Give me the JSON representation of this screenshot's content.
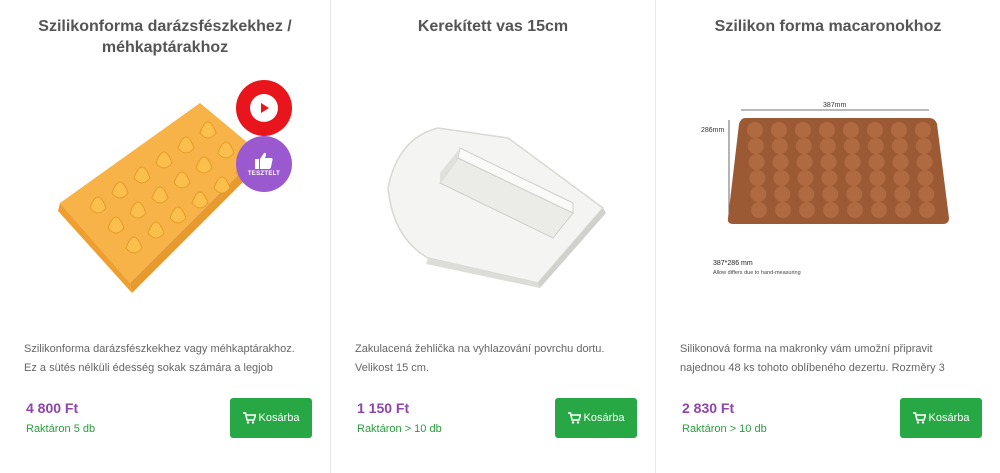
{
  "products": [
    {
      "title": "Szilikonforma darázsfészkekhez / méhkaptárakhoz",
      "description": "Szilikonforma darázsfészkekhez vagy méhkaptárakhoz. Ez a sütés nélküli édesség sokak számára a legjob",
      "price": "4 800 Ft",
      "stock": "Raktáron 5 db",
      "cart_label": "Kosárba",
      "badges": {
        "tested_label": "TESZTELT"
      }
    },
    {
      "title": "Kerekített vas 15cm",
      "description": "Zakulacená žehlička na vyhlazování povrchu dortu. Velikost 15 cm.",
      "price": "1 150 Ft",
      "stock": "Raktáron > 10 db",
      "cart_label": "Kosárba"
    },
    {
      "title": "Szilikon forma macaronokhoz",
      "description": "Silikonová forma na makronky vám umožní připravit najednou 48 ks tohoto oblíbeného dezertu. Rozměry 3",
      "price": "2 830 Ft",
      "stock": "Raktáron > 10 db",
      "cart_label": "Kosárba",
      "image_labels": {
        "width": "387mm",
        "height": "286mm",
        "dims": "387*286 mm",
        "note": "Allow differs due to hand-measuring"
      }
    }
  ],
  "colors": {
    "price": "#8e44ad",
    "stock": "#2a9d3d",
    "button": "#28a745",
    "video_badge": "#e8161c",
    "tested_badge": "#9b59d0"
  },
  "icons": {
    "cart": "cart-icon",
    "video": "play-icon",
    "tested": "thumbs-up-icon"
  }
}
